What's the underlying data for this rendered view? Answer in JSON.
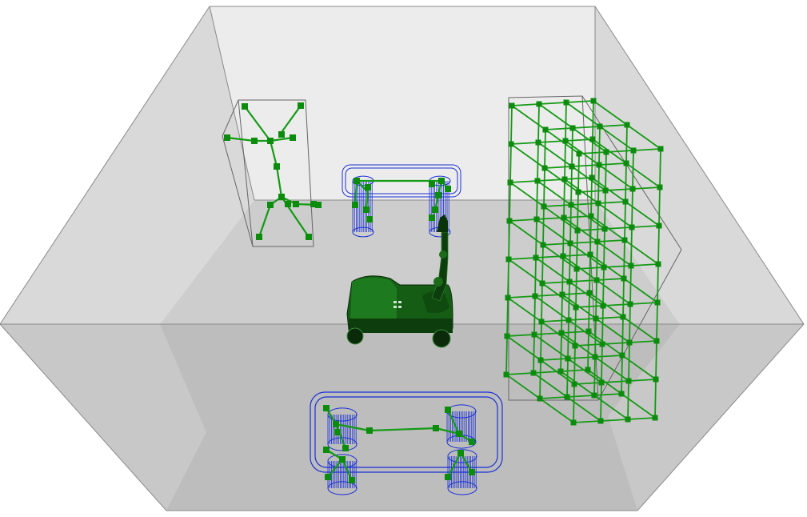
{
  "colors": {
    "background": "#ffffff",
    "wall_far": "#ececec",
    "wall_left": "#d6d6d6",
    "wall_right": "#d6d6d6",
    "floor_far": "#cfcfcf",
    "floor_near": "#bdbdbd",
    "edge": "#888888",
    "graph_green": "#149a14",
    "node_green": "#0c8c0c",
    "cylinder_blue": "#1a2fd6",
    "robot_dark": "#0d3d0d",
    "robot_mid": "#1d6b1d"
  },
  "scene": {
    "objects": [
      {
        "name": "room",
        "icon": "room-icon"
      },
      {
        "name": "human-figure-skeleton",
        "icon": "skeleton-icon"
      },
      {
        "name": "table-far",
        "icon": "table-icon"
      },
      {
        "name": "table-near",
        "icon": "table-icon"
      },
      {
        "name": "shelf-grid",
        "icon": "grid-icon"
      },
      {
        "name": "mobile-manipulator-robot",
        "icon": "robot-icon"
      }
    ]
  }
}
